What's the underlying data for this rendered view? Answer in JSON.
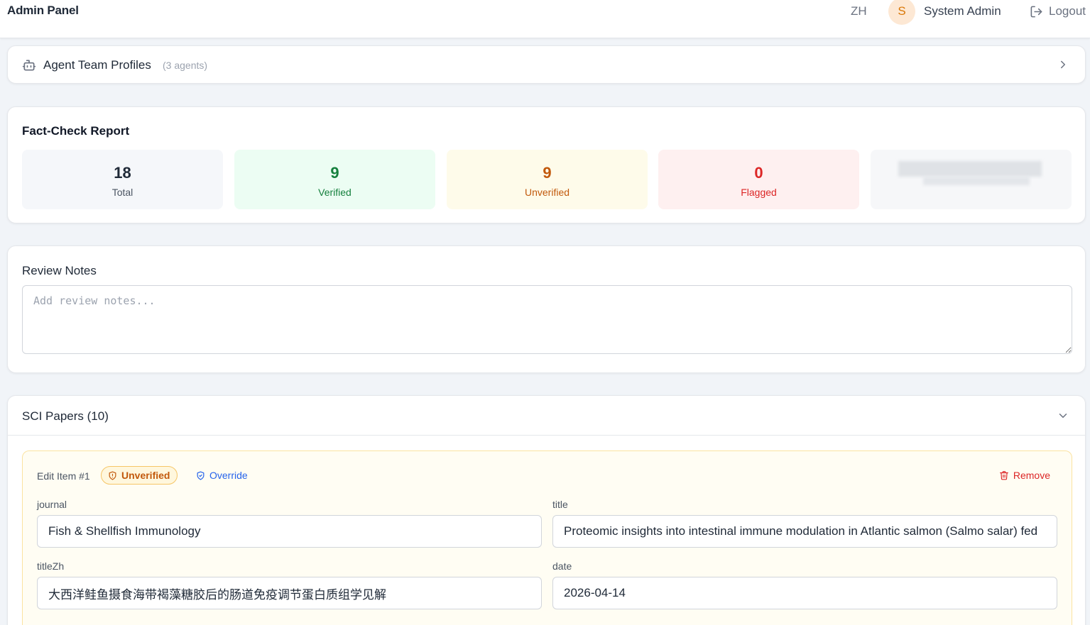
{
  "header": {
    "brand": "Admin Panel",
    "language": "ZH",
    "avatar_initial": "S",
    "username": "System Admin",
    "logout_label": "Logout"
  },
  "agents": {
    "title": "Agent Team Profiles",
    "count": "(3 agents)"
  },
  "report": {
    "title": "Fact-Check Report",
    "stats": [
      {
        "value": "18",
        "label": "Total"
      },
      {
        "value": "9",
        "label": "Verified"
      },
      {
        "value": "9",
        "label": "Unverified"
      },
      {
        "value": "0",
        "label": "Flagged"
      }
    ]
  },
  "notes": {
    "title": "Review Notes",
    "placeholder": "Add review notes..."
  },
  "papers": {
    "title": "SCI Papers (10)",
    "item": {
      "heading": "Edit Item #1",
      "status": "Unverified",
      "override_label": "Override",
      "remove_label": "Remove",
      "fields": {
        "journal_label": "journal",
        "journal_value": "Fish & Shellfish Immunology",
        "title_label": "title",
        "title_value": "Proteomic insights into intestinal immune modulation in Atlantic salmon (Salmo salar) fed",
        "titleZh_label": "titleZh",
        "titleZh_value": "大西洋鲑鱼摄食海带褐藻糖胶后的肠道免疫调节蛋白质组学见解",
        "date_label": "date",
        "date_value": "2026-04-14"
      }
    }
  },
  "colors": {
    "accent_blue": "#2563eb",
    "verified_green": "#15803d",
    "unverified_orange": "#c2590c",
    "flagged_red": "#dc2626"
  }
}
